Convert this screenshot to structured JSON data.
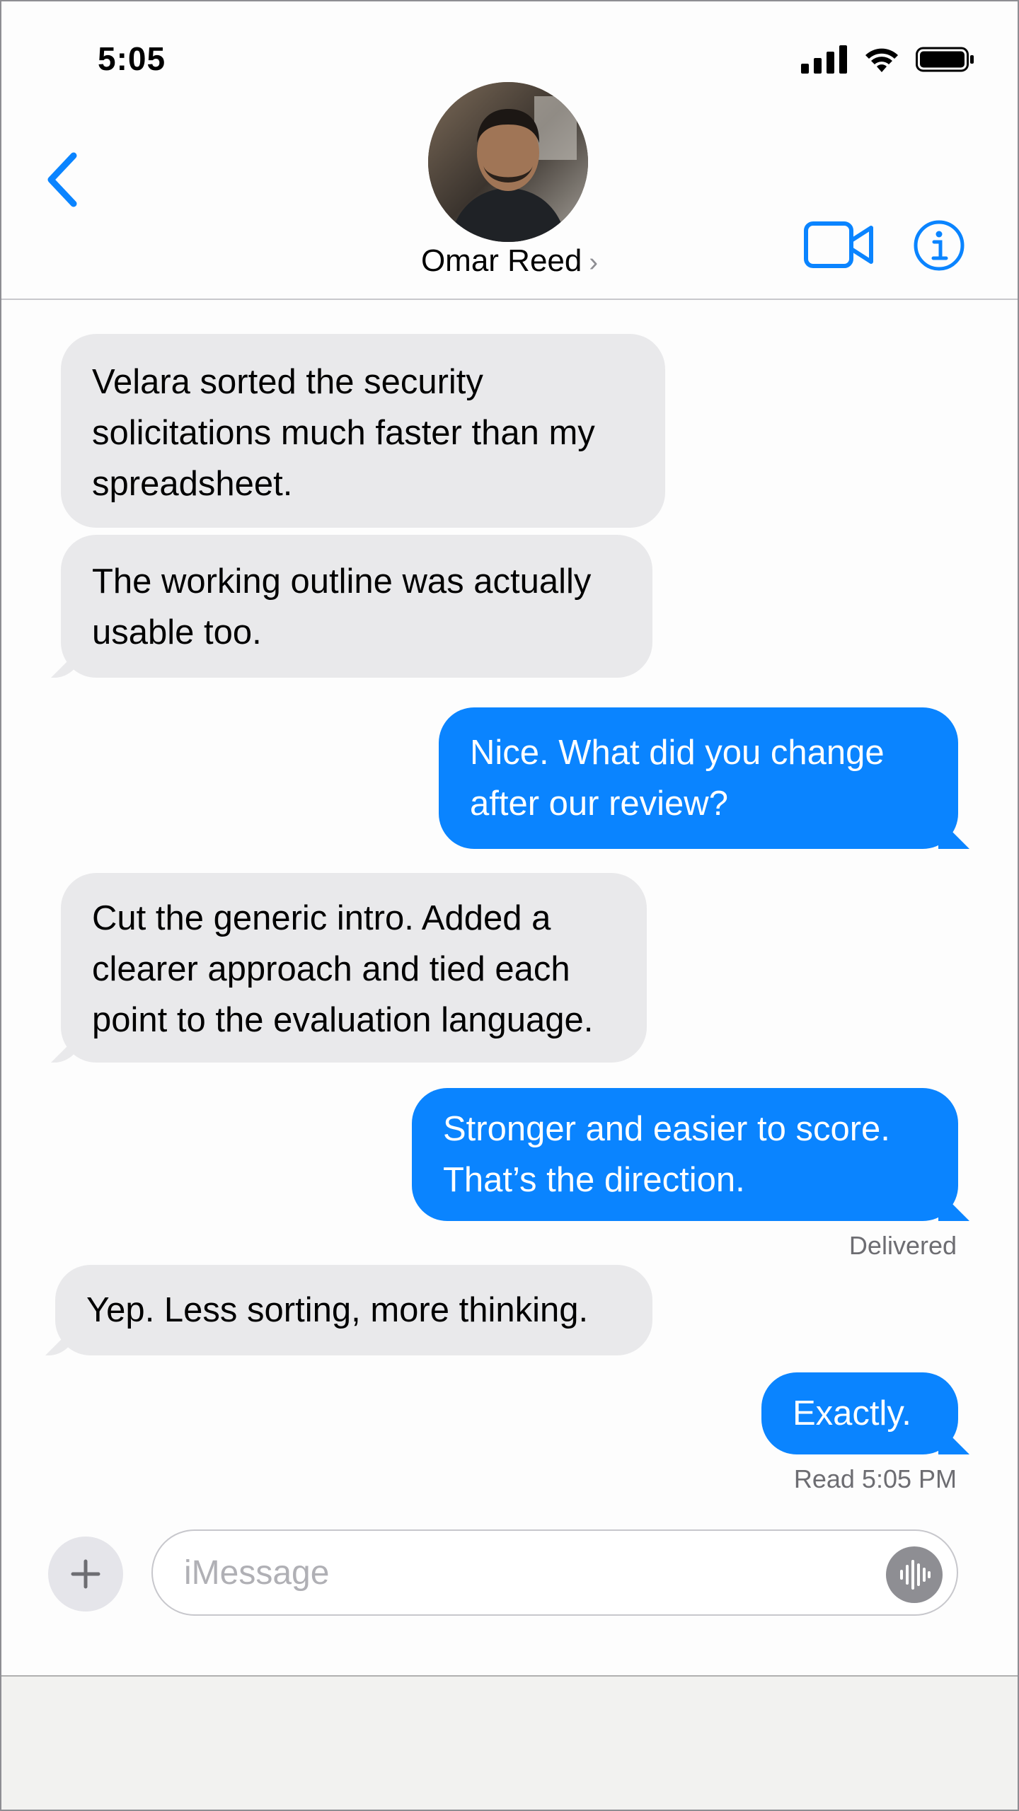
{
  "status_bar": {
    "time": "5:05",
    "icons": [
      "signal-icon",
      "wifi-icon",
      "battery-icon"
    ]
  },
  "header": {
    "back_icon": "chevron-left-icon",
    "contact_name": "Omar Reed",
    "name_chevron": "›",
    "video_icon": "video-camera-icon",
    "info_icon": "info-icon"
  },
  "messages": [
    {
      "direction": "incoming",
      "lines": [
        "Velara sorted the security",
        "solicitations much faster than my",
        "spreadsheet."
      ]
    },
    {
      "direction": "incoming",
      "lines": [
        "The working outline was actually",
        "usable too."
      ]
    },
    {
      "direction": "outgoing",
      "lines": [
        "Nice. What did you change",
        "after our review?"
      ]
    },
    {
      "direction": "incoming",
      "lines": [
        "Cut the generic intro. Added a",
        "clearer approach and tied each",
        "point to the evaluation language."
      ]
    },
    {
      "direction": "outgoing",
      "lines": [
        "Stronger and easier to score.",
        "That’s the direction."
      ]
    },
    {
      "direction": "incoming",
      "lines": [
        "Yep. Less sorting, more thinking."
      ]
    },
    {
      "direction": "outgoing",
      "lines": [
        "Exactly."
      ]
    }
  ],
  "receipts": {
    "delivered": "Delivered",
    "read": "Read 5:05 PM"
  },
  "compose": {
    "plus_icon": "plus-icon",
    "placeholder": "iMessage",
    "voice_icon": "audio-waveform-icon"
  },
  "colors": {
    "accent": "#0a84ff",
    "incoming_bubble": "#e9e9eb",
    "receipt_text": "#6d6d72"
  }
}
